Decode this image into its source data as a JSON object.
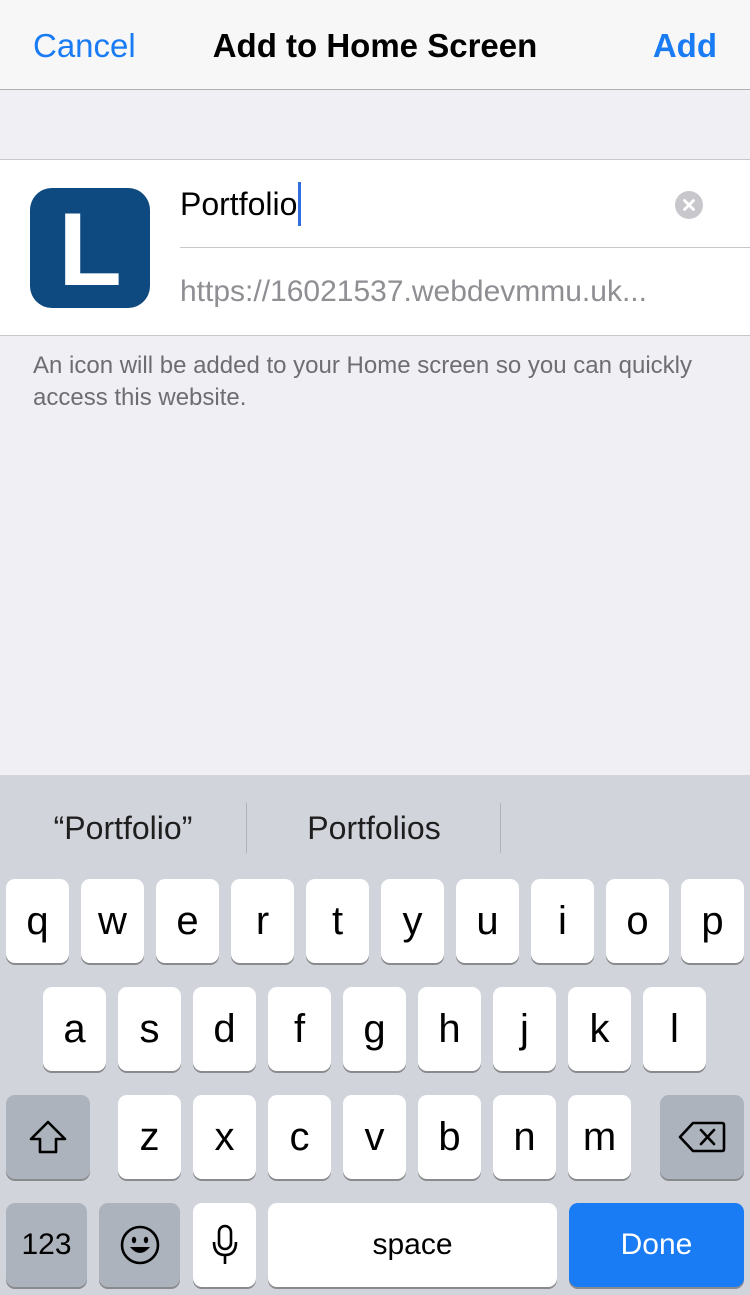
{
  "nav": {
    "cancel_label": "Cancel",
    "title": "Add to Home Screen",
    "add_label": "Add"
  },
  "card": {
    "icon_letter": "L",
    "icon_color": "#0e4a80",
    "name_value": "Portfolio",
    "url": "https://16021537.webdevmmu.uk..."
  },
  "hint": "An icon will be added to your Home screen so you can quickly access this website.",
  "keyboard": {
    "suggestions": [
      "“Portfolio”",
      "Portfolios"
    ],
    "row1": [
      "q",
      "w",
      "e",
      "r",
      "t",
      "y",
      "u",
      "i",
      "o",
      "p"
    ],
    "row2": [
      "a",
      "s",
      "d",
      "f",
      "g",
      "h",
      "j",
      "k",
      "l"
    ],
    "row3": [
      "z",
      "x",
      "c",
      "v",
      "b",
      "n",
      "m"
    ],
    "numbers_label": "123",
    "space_label": "space",
    "done_label": "Done",
    "shift_icon": "shift-arrow-icon",
    "backspace_icon": "delete-backward-icon",
    "emoji_icon": "emoji-smiley-icon",
    "dictation_icon": "microphone-icon"
  },
  "colors": {
    "accent": "#1a7cf4",
    "background": "#efeff4",
    "keyboard_bg": "#d1d5db"
  }
}
